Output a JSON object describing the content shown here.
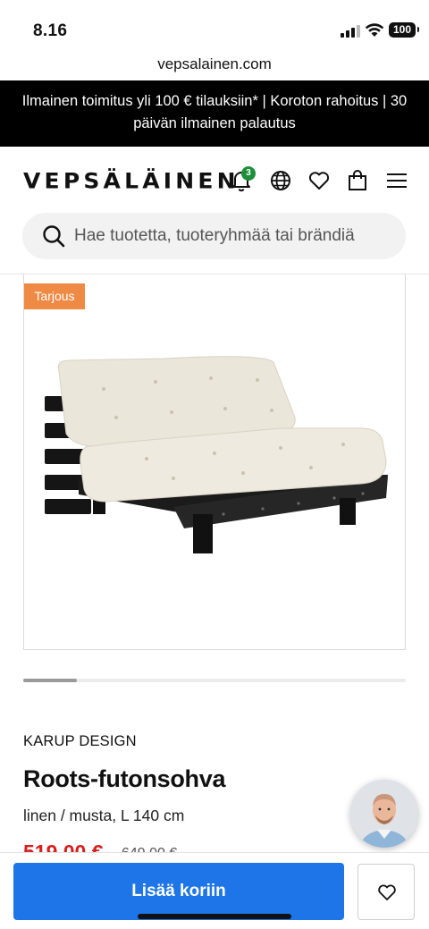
{
  "status_bar": {
    "time": "8.16",
    "battery": "100"
  },
  "browser": {
    "url": "vepsalainen.com"
  },
  "promo": {
    "text": "Ilmainen toimitus yli 100 € tilauksiin* | Koroton rahoitus | 30 päivän ilmainen palautus"
  },
  "header": {
    "logo": "VEPSÄLÄINEN",
    "notification_count": "3",
    "icons": [
      "bell-icon",
      "globe-icon",
      "heart-icon",
      "bag-icon",
      "menu-icon"
    ]
  },
  "search": {
    "placeholder": "Hae tuotetta, tuoteryhmää tai brändiä"
  },
  "product": {
    "tag": "Tarjous",
    "brand": "KARUP DESIGN",
    "name": "Roots-futonsohva",
    "variant": "linen / musta, L 140 cm",
    "price": "519,00 €",
    "old_price": "649,00 €",
    "image_progress": 0.14
  },
  "actions": {
    "add_to_cart": "Lisää koriin"
  },
  "colors": {
    "accent": "#1e75e8",
    "promo_bg": "#000000",
    "tag_bg": "#ef8a45",
    "price": "#d42020",
    "badge": "#1e8f3a"
  }
}
